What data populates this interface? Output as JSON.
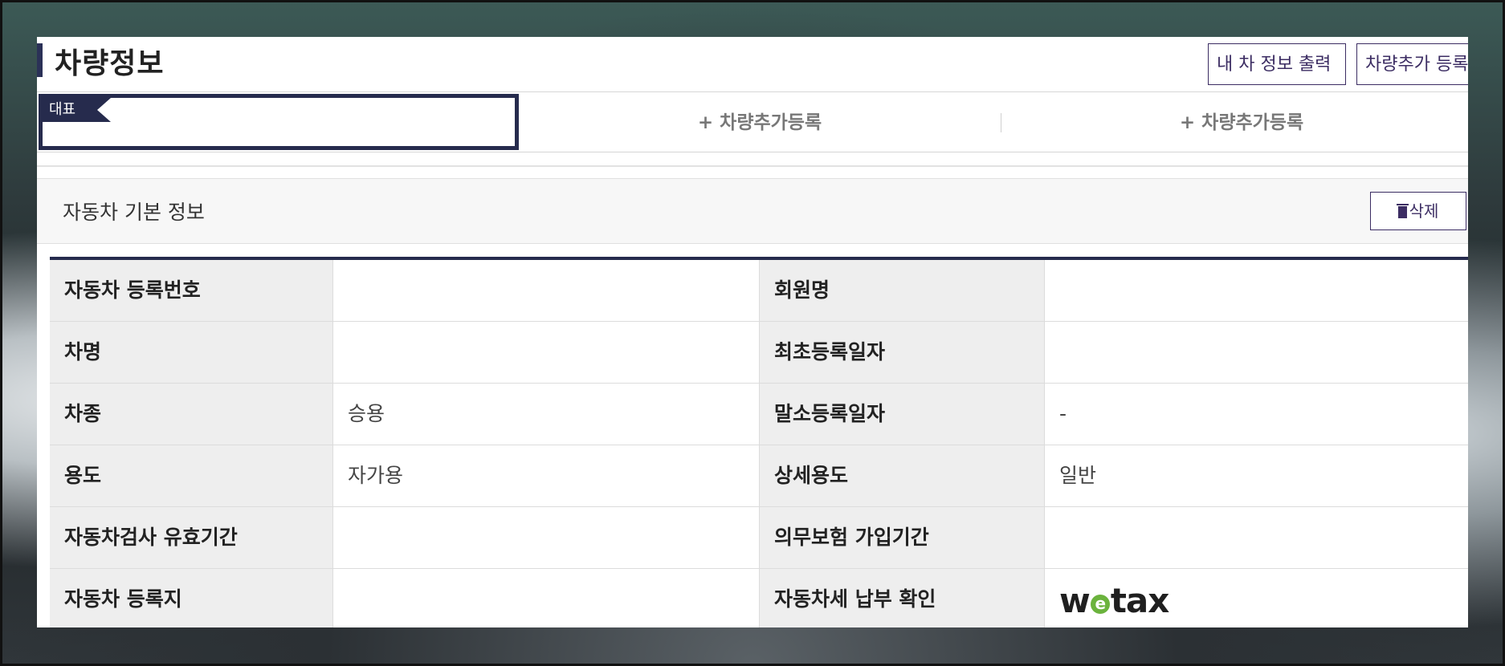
{
  "header": {
    "title": "차량정보",
    "print_button": "내 차 정보 출력",
    "add_button": "차량추가 등록"
  },
  "tabs": {
    "representative_badge": "대표",
    "add_tab_1": "+ 차량추가등록",
    "add_tab_2": "+ 차량추가등록"
  },
  "section": {
    "title": "자동차 기본 정보",
    "delete_button": "삭제"
  },
  "table": {
    "rows": [
      {
        "label_left": "자동차 등록번호",
        "value_left": "",
        "label_right": "회원명",
        "value_right": ""
      },
      {
        "label_left": "차명",
        "value_left": "",
        "label_right": "최초등록일자",
        "value_right": ""
      },
      {
        "label_left": "차종",
        "value_left": "승용",
        "label_right": "말소등록일자",
        "value_right": "-"
      },
      {
        "label_left": "용도",
        "value_left": "자가용",
        "label_right": "상세용도",
        "value_right": "일반"
      },
      {
        "label_left": "자동차검사 유효기간",
        "value_left": "",
        "label_right": "의무보험 가입기간",
        "value_right": ""
      },
      {
        "label_left": "자동차 등록지",
        "value_left": "",
        "label_right": "자동차세 납부 확인",
        "value_right": "wetax"
      }
    ]
  },
  "icons": {
    "delete": "trash-icon",
    "tax_link": "wetax-logo"
  },
  "colors": {
    "accent": "#262b4d",
    "button": "#3c2d63",
    "wetax_green": "#6bb33d"
  }
}
